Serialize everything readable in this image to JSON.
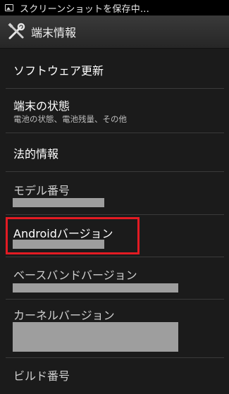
{
  "status_bar": {
    "icon": "screenshot-image-icon",
    "notification_text": "スクリーンショットを保存中..."
  },
  "title_bar": {
    "icon": "tools-icon",
    "title": "端末情報"
  },
  "items": [
    {
      "title": "ソフトウェア更新"
    },
    {
      "title": "端末の状態",
      "subtitle": "電池の状態、電池残量、その他"
    },
    {
      "title": "法的情報"
    },
    {
      "title": "モデル番号"
    },
    {
      "title": "Androidバージョン"
    },
    {
      "title": "ベースバンドバージョン"
    },
    {
      "title": "カーネルバージョン"
    },
    {
      "title": "ビルド番号"
    }
  ],
  "colors": {
    "background": "#1b1b1b",
    "highlight": "#e31b23",
    "redaction": "#9e9e9e"
  }
}
